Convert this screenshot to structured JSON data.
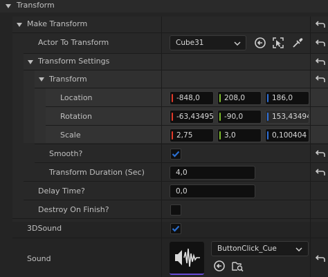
{
  "section": {
    "title": "Transform"
  },
  "make_transform": {
    "label": "Make Transform"
  },
  "actor": {
    "label": "Actor To Transform",
    "value": "Cube31"
  },
  "transform_settings": {
    "label": "Transform Settings"
  },
  "transform": {
    "label": "Transform"
  },
  "location": {
    "label": "Location",
    "x": "-848,0",
    "y": "208,0",
    "z": "186,0"
  },
  "rotation": {
    "label": "Rotation",
    "x": "-63,43495",
    "y": "-90,0",
    "z": "153,43494"
  },
  "scale": {
    "label": "Scale",
    "x": "2,75",
    "y": "3,0",
    "z": "0,100404"
  },
  "smooth": {
    "label": "Smooth?",
    "checked": true
  },
  "duration": {
    "label": "Transform Duration (Sec)",
    "value": "4,0"
  },
  "delay": {
    "label": "Delay Time?",
    "value": "0,0"
  },
  "destroy": {
    "label": "Destroy On Finish?",
    "checked": false
  },
  "sound3d": {
    "label": "3DSound",
    "checked": true
  },
  "sound": {
    "label": "Sound",
    "value": "ButtonClick_Cue"
  },
  "colors": {
    "x_axis": "#e23a2a",
    "y_axis": "#7dbd2c",
    "z_axis": "#2f6fd6",
    "check": "#2b6fd1"
  }
}
